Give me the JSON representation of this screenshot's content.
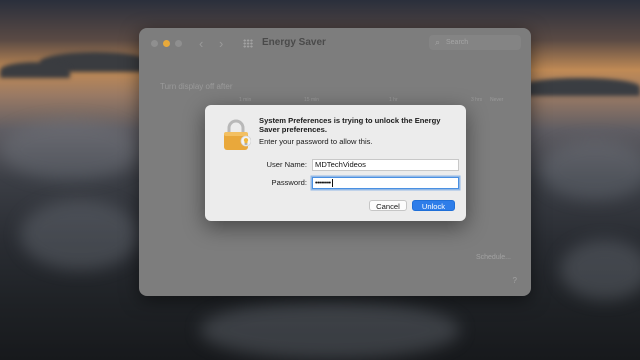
{
  "window": {
    "title": "Energy Saver",
    "search_placeholder": "Search",
    "background_label": "Turn display off after",
    "slider_ticks": [
      "1 min",
      "15 min",
      "1 hr",
      "3 hrs",
      "Never"
    ],
    "schedule_label": "Schedule...",
    "help_label": "?"
  },
  "dialog": {
    "message": "System Preferences is trying to unlock the Energy Saver preferences.",
    "subtext": "Enter your password to allow this.",
    "username_label": "User Name:",
    "username_value": "MDTechVideos",
    "password_label": "Password:",
    "password_value": "••••••••",
    "cancel_label": "Cancel",
    "unlock_label": "Unlock"
  },
  "colors": {
    "accent": "#2e7de9",
    "lock_gold": "#e9a83b"
  }
}
